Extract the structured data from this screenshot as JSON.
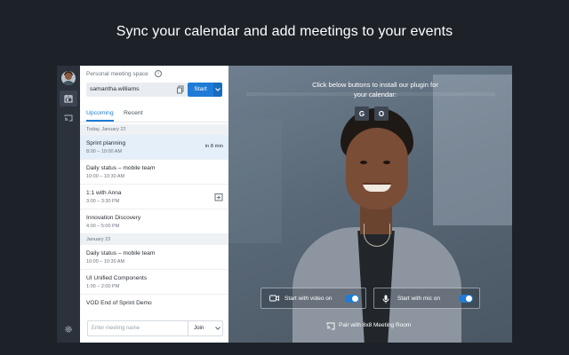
{
  "headline": "Sync your calendar and add meetings to your events",
  "sidebar": {
    "avatar_icon": "user-avatar",
    "items": [
      {
        "icon": "calendar-icon",
        "active": true
      },
      {
        "icon": "cast-icon",
        "active": false
      }
    ],
    "settings_icon": "gear-icon"
  },
  "meeting_space": {
    "label": "Personal meeting space",
    "room_name": "samantha.williams",
    "start_label": "Start"
  },
  "tabs": [
    {
      "label": "Upcoming",
      "active": true
    },
    {
      "label": "Recent",
      "active": false
    }
  ],
  "schedule": [
    {
      "day": "Today, January 22",
      "events": [
        {
          "title": "Sprint planning",
          "time": "8:00 – 10:00 AM",
          "note": "in 8 min",
          "selected": true
        },
        {
          "title": "Daily status – mobile team",
          "time": "10:00 – 10:30 AM"
        },
        {
          "title": "1:1 with Anna",
          "time": "3:00 – 3:30 PM",
          "add_icon": true
        },
        {
          "title": "Innovation Discovery",
          "time": "4:00 – 5:00 PM"
        }
      ]
    },
    {
      "day": "January 23",
      "events": [
        {
          "title": "Daily status – mobile team",
          "time": "10:00 – 10:30 AM"
        },
        {
          "title": "UI Unified Components",
          "time": "1:00 – 2:00 PM"
        },
        {
          "title": "VOD End of Sprint Demo",
          "time": ""
        }
      ]
    }
  ],
  "join": {
    "placeholder": "Enter meeting name",
    "button_label": "Join"
  },
  "preview": {
    "install_text": "Click below buttons to install our plugin for your calendar:",
    "google_glyph": "G",
    "office_glyph": "O",
    "video_toggle": {
      "label": "Start with video on",
      "on": true
    },
    "mic_toggle": {
      "label": "Start with mic on",
      "on": true
    },
    "pair_label": "Pair with 8x8 Meeting Room"
  },
  "colors": {
    "accent": "#1f7bd6",
    "rail": "#2b323c",
    "page_bg": "#1d2229"
  }
}
